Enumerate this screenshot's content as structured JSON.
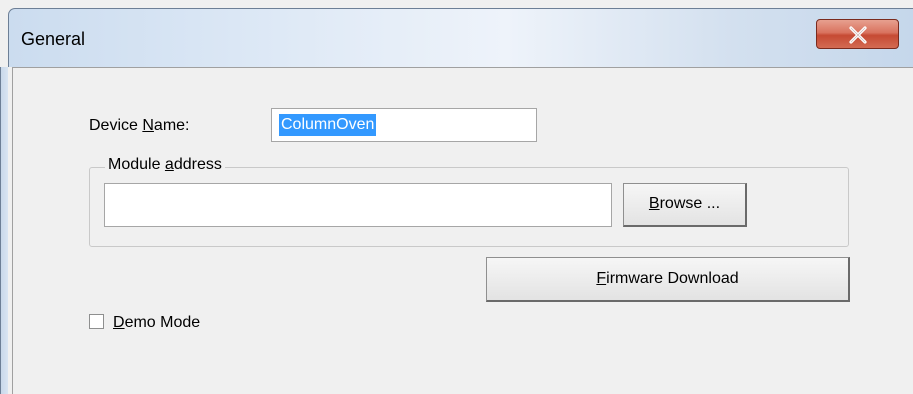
{
  "window": {
    "title": "General",
    "close_icon": "close-x-icon"
  },
  "form": {
    "device_name_label_pre": "Device ",
    "device_name_label_mnemonic": "N",
    "device_name_label_post": "ame:",
    "device_name_value": "ColumnOven",
    "module_address_label_pre": "Module ",
    "module_address_label_mnemonic": "a",
    "module_address_label_post": "ddress",
    "module_address_value": "",
    "browse_mnemonic": "B",
    "browse_rest": "rowse ...",
    "firmware_mnemonic": "F",
    "firmware_rest": "irmware Download",
    "demo_mode_mnemonic": "D",
    "demo_mode_rest": "emo Mode",
    "demo_mode_checked": false
  },
  "colors": {
    "selection": "#3399ff",
    "close_button": "#c64a33"
  }
}
